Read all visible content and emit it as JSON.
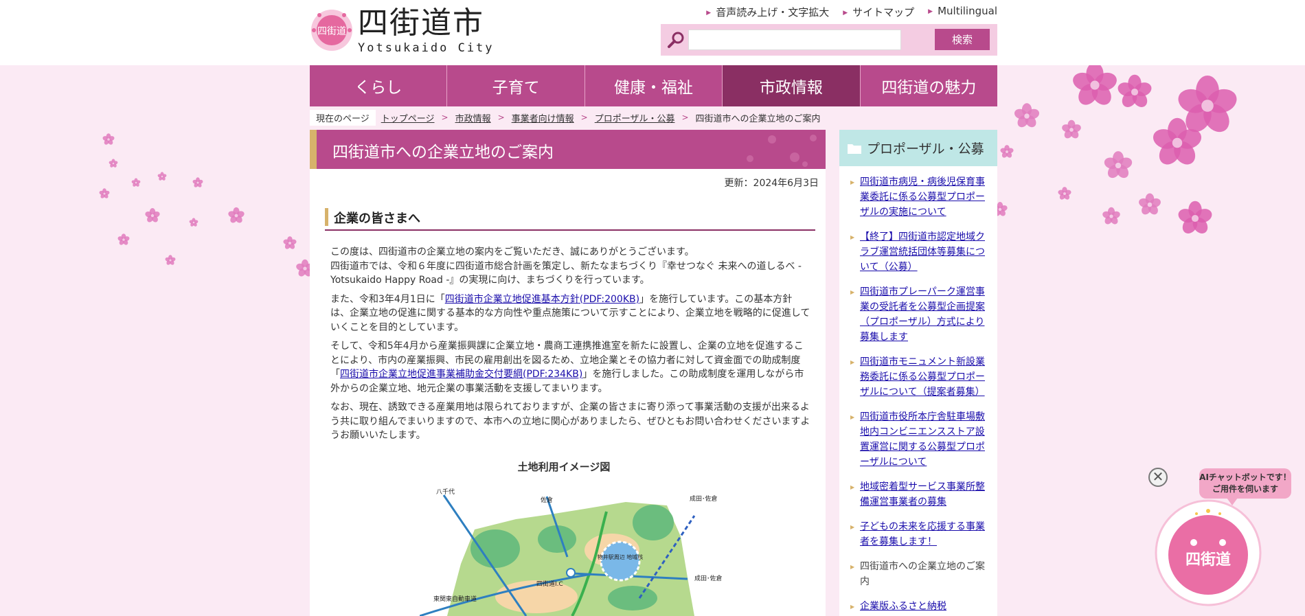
{
  "header": {
    "logo_jp": "四街道市",
    "logo_en": "Yotsukaido  City",
    "util_links": [
      "音声読み上げ・文字拡大",
      "サイトマップ",
      "Multilingual"
    ],
    "search_placeholder": "",
    "search_button": "検索"
  },
  "nav": {
    "items": [
      "くらし",
      "子育て",
      "健康・福祉",
      "市政情報",
      "四街道の魅力"
    ],
    "active": "市政情報"
  },
  "breadcrumb": {
    "label": "現在のページ",
    "links": [
      "トップページ",
      "市政情報",
      "事業者向け情報",
      "プロポーザル・公募"
    ],
    "current": "四街道市への企業立地のご案内"
  },
  "main": {
    "title": "四街道市への企業立地のご案内",
    "updated": "更新：2024年6月3日",
    "section_heading": "企業の皆さまへ",
    "para1": "この度は、四街道市の企業立地の案内をご覧いただき、誠にありがとうございます。",
    "para1b": "四街道市では、令和６年度に四街道市総合計画を策定し、新たなまちづくり『幸せつなぐ 未来への道しるべ - Yotsukaido Happy Road -』の実現に向け、まちづくりを行っています。",
    "para2_pre": "また、令和3年4月1日に「",
    "para2_link": "四街道市企業立地促進基本方針(PDF:200KB)",
    "para2_post": "」を施行しています。この基本方針は、企業立地の促進に関する基本的な方向性や重点施策について示すことにより、企業立地を戦略的に促進していくことを目的としています。",
    "para3_pre": "そして、令和5年4月から産業振興課に企業立地・農商工連携推進室を新たに設置し、企業の立地を促進することにより、市内の産業振興、市民の雇用創出を図るため、立地企業とその協力者に対して資金面での助成制度「",
    "para3_link": "四街道市企業立地促進事業補助金交付要綱(PDF:234KB)",
    "para3_post": "」を施行しました。この助成制度を運用しながら市外からの企業立地、地元企業の事業活動を支援してまいります。",
    "para4": "なお、現在、誘致できる産業用地は限られておりますが、企業の皆さまに寄り添って事業活動の支援が出来るよう共に取り組んでまいりますので、本市への立地に関心がありましたら、ぜひともお問い合わせくださいますようお願いいたします。",
    "map_title": "土地利用イメージ図",
    "map_labels": {
      "yachiyo": "八千代",
      "sakura": "佐倉",
      "narita_sakura_top": "成田･佐倉",
      "narita_sakura_right": "成田･佐倉",
      "ekimae": "物井駅周辺\n地域核",
      "ic": "四街道I.C",
      "expressway": "東関東自動車道"
    }
  },
  "sidebar": {
    "heading": "プロポーザル・公募",
    "items": [
      "四街道市病児・病後児保育事業委託に係る公募型プロポーザルの実施について",
      "【終了】四街道市認定地域クラブ運営統括団体等募集について（公募）",
      "四街道市プレーパーク運営事業の受託者を公募型企画提案（プロポーザル）方式により募集します",
      "四街道市モニュメント新設業務委託に係る公募型プロポーザルについて（提案者募集）",
      "四街道市役所本庁舎駐車場敷地内コンビニエンスストア設置運営に関する公募型プロポーザルについて",
      "地域密着型サービス事業所整備運営事業者の募集",
      "子どもの未来を応援する事業者を募集します！",
      "四街道市への企業立地のご案内",
      "企業版ふるさと納税"
    ],
    "current_index": 7
  },
  "chatbot": {
    "close": "✕",
    "line1": "AIチャットボットです！",
    "line2": "ご用件を伺います",
    "mascot_text": "四\n街\n道"
  },
  "colors": {
    "brand": "#b84a8c",
    "nav_active": "#8a2f63",
    "gold": "#d7b26b",
    "side_head": "#bfe7e6",
    "page_bg": "#fbeaf4"
  }
}
